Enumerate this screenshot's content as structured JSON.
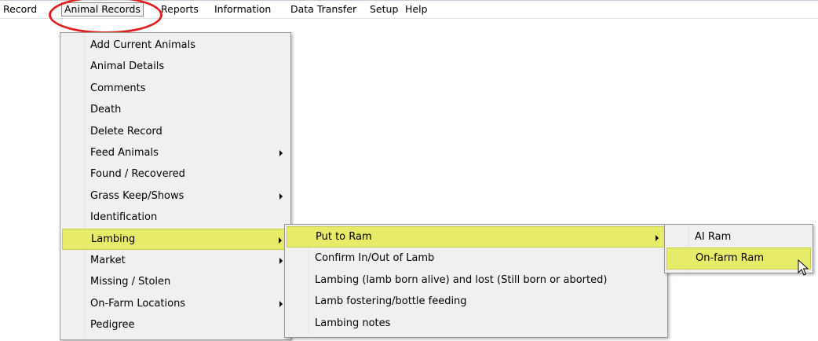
{
  "menubar": {
    "items": [
      "Record",
      "Animal Records",
      "Reports",
      "Information",
      "Data Transfer",
      "Setup",
      "Help"
    ]
  },
  "menu_animal_records": {
    "items": [
      {
        "label": "Add Current Animals",
        "submenu": false
      },
      {
        "label": "Animal Details",
        "submenu": false
      },
      {
        "label": "Comments",
        "submenu": false
      },
      {
        "label": "Death",
        "submenu": false
      },
      {
        "label": "Delete Record",
        "submenu": false
      },
      {
        "label": "Feed Animals",
        "submenu": true
      },
      {
        "label": "Found / Recovered",
        "submenu": false
      },
      {
        "label": "Grass Keep/Shows",
        "submenu": true
      },
      {
        "label": "Identification",
        "submenu": false
      },
      {
        "label": "Lambing",
        "submenu": true,
        "highlighted": true
      },
      {
        "label": "Market",
        "submenu": true
      },
      {
        "label": "Missing / Stolen",
        "submenu": false
      },
      {
        "label": "On-Farm Locations",
        "submenu": true
      },
      {
        "label": "Pedigree",
        "submenu": false
      }
    ]
  },
  "menu_lambing": {
    "items": [
      {
        "label": "Put to Ram",
        "submenu": true,
        "highlighted": true
      },
      {
        "label": "Confirm In/Out of Lamb",
        "submenu": false
      },
      {
        "label": "Lambing (lamb born alive) and  lost (Still born or aborted)",
        "submenu": false
      },
      {
        "label": "Lamb fostering/bottle feeding",
        "submenu": false
      },
      {
        "label": "Lambing notes",
        "submenu": false
      }
    ]
  },
  "menu_put_to_ram": {
    "items": [
      {
        "label": "AI Ram",
        "submenu": false
      },
      {
        "label": "On-farm Ram",
        "submenu": false,
        "highlighted": true
      }
    ]
  },
  "colors": {
    "highlight": "#e6eb6a",
    "annotation_ring": "#e02020",
    "menu_bg": "#f0f0f0"
  }
}
